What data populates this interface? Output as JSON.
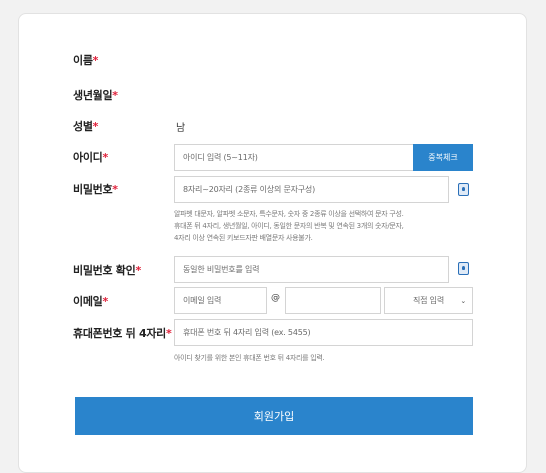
{
  "form": {
    "name": {
      "label": "이름",
      "required": "*"
    },
    "birth": {
      "label": "생년월일",
      "required": "*"
    },
    "gender": {
      "label": "성별",
      "required": "*",
      "value": "남"
    },
    "userid": {
      "label": "아이디",
      "required": "*",
      "placeholder": "아이디 입력 (5~11자)",
      "check_button": "중복체크"
    },
    "password": {
      "label": "비밀번호",
      "required": "*",
      "placeholder": "8자리~20자리 (2종류 이상의 문자구성)",
      "help": [
        "알파벳 대문자, 알파벳 소문자, 특수문자, 숫자 중 2종류 이상을 선택하여 문자 구성.",
        "휴대폰 뒤 4자리, 생년월일, 아이디, 동일한 문자의 반복 및 연속된 3개의 숫자/문자,",
        "4자리 이상 연속된 키보드자판 배열문자 사용불가."
      ]
    },
    "password_confirm": {
      "label": "비밀번호 확인",
      "required": "*",
      "placeholder": "동일한 비밀번호를 입력"
    },
    "email": {
      "label": "이메일",
      "required": "*",
      "local_placeholder": "이메일 입력",
      "at": "@",
      "domain_select": "직접 입력"
    },
    "phone": {
      "label": "휴대폰번호 뒤 4자리",
      "required": "*",
      "placeholder": "휴대폰 번호 뒤 4자리 입력 (ex. 5455)",
      "help": "아이디 찾기를 위한 본인 휴대폰 번호 뒤 4자리를 입력."
    },
    "submit": "회원가입"
  },
  "icons": {
    "password_toggle": "lock-icon",
    "select_arrow": "chevron-down-icon"
  },
  "colors": {
    "primary": "#2a84cc",
    "required": "#e0203a"
  }
}
